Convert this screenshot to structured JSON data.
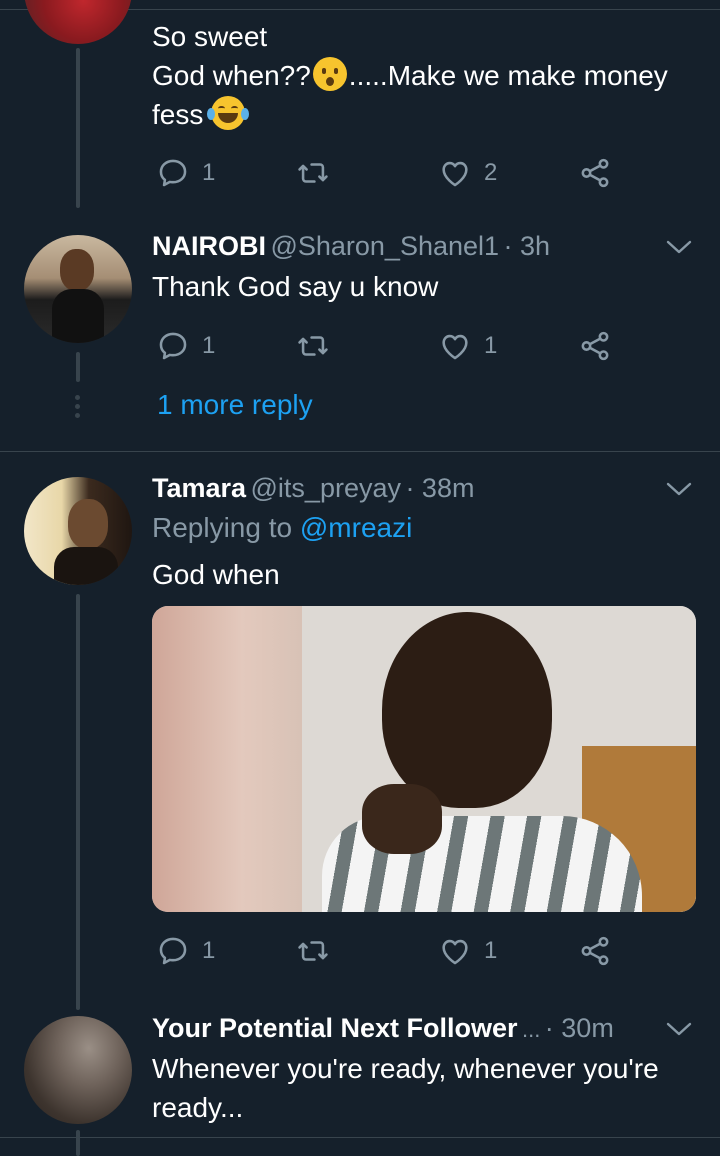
{
  "tweet1": {
    "lines": [
      "So sweet",
      "God when??",
      ".....Make we make money",
      "fess"
    ],
    "emoji1": "hushed-face-emoji",
    "emoji2": "tears-of-joy-emoji",
    "reply_count": "1",
    "like_count": "2"
  },
  "tweet2": {
    "name": "NAIROBI",
    "handle": "@Sharon_Shanel1",
    "time": "· 3h",
    "text": "Thank God say u know",
    "reply_count": "1",
    "like_count": "1",
    "more_replies": "1 more reply"
  },
  "tweet3": {
    "name": "Tamara",
    "handle": "@its_preyay",
    "time": "· 38m",
    "replying_prefix": "Replying to",
    "replying_to": "@mreazi",
    "text": "God when",
    "reply_count": "1",
    "like_count": "1"
  },
  "tweet4": {
    "name": "Your Potential Next Follower",
    "ellipsis": "...",
    "time": "· 30m",
    "text_line1": "Whenever you're ready, whenever you're",
    "text_line2": "ready..."
  },
  "colors": {
    "background": "#15202b",
    "secondary_text": "#8899a6",
    "link": "#1da1f2",
    "divider": "#38444d"
  },
  "icons": [
    "reply-icon",
    "retweet-icon",
    "like-icon",
    "share-icon",
    "chevron-down-icon"
  ]
}
